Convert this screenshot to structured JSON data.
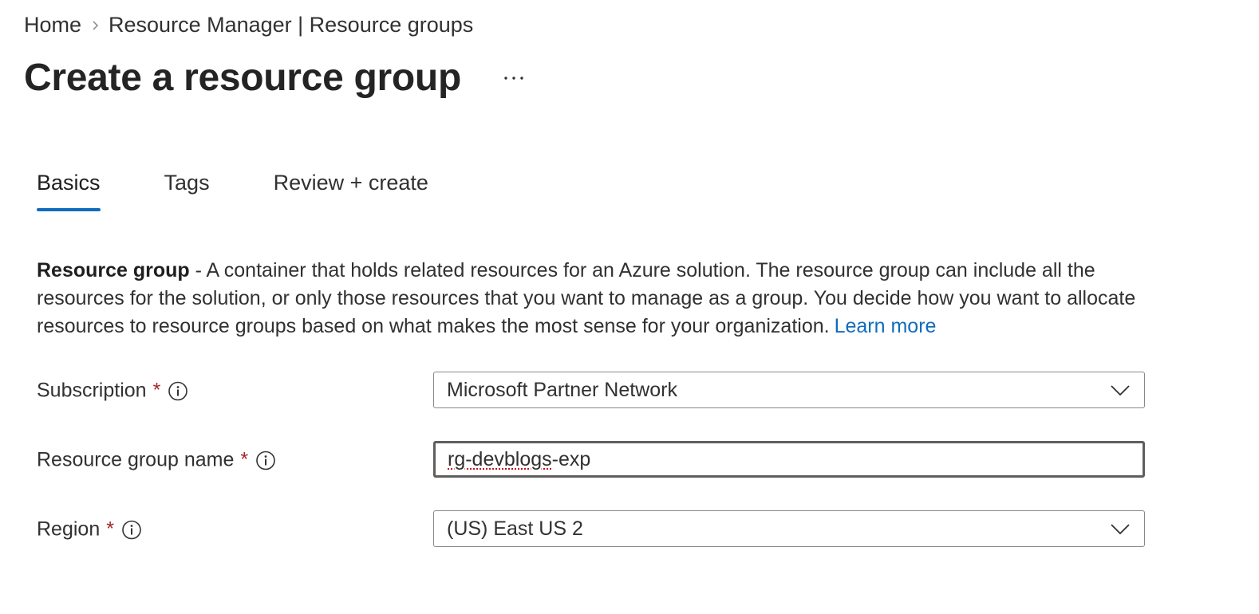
{
  "breadcrumb": {
    "home": "Home",
    "current": "Resource Manager | Resource groups"
  },
  "page": {
    "title": "Create a resource group",
    "more_label": "..."
  },
  "tabs": [
    {
      "label": "Basics",
      "active": true
    },
    {
      "label": "Tags",
      "active": false
    },
    {
      "label": "Review + create",
      "active": false
    }
  ],
  "description": {
    "term": "Resource group",
    "text": " - A container that holds related resources for an Azure solution. The resource group can include all the resources for the solution, or only those resources that you want to manage as a group. You decide how you want to allocate resources to resource groups based on what makes the most sense for your organization.",
    "learn_more": "Learn more"
  },
  "form": {
    "required_mark": "*",
    "subscription": {
      "label": "Subscription",
      "value": "Microsoft Partner Network"
    },
    "resource_group_name": {
      "label": "Resource group name",
      "value_part1": "rg-devblogs",
      "value_part2": "-exp"
    },
    "region": {
      "label": "Region",
      "value": "(US) East US 2"
    }
  },
  "colors": {
    "accent": "#0f6cbd",
    "required": "#a4262c",
    "text": "#323130"
  },
  "icons": {
    "breadcrumb_separator": "chevron-right-icon",
    "info": "info-icon",
    "dropdown": "chevron-down-icon",
    "more": "more-horizontal-icon"
  }
}
